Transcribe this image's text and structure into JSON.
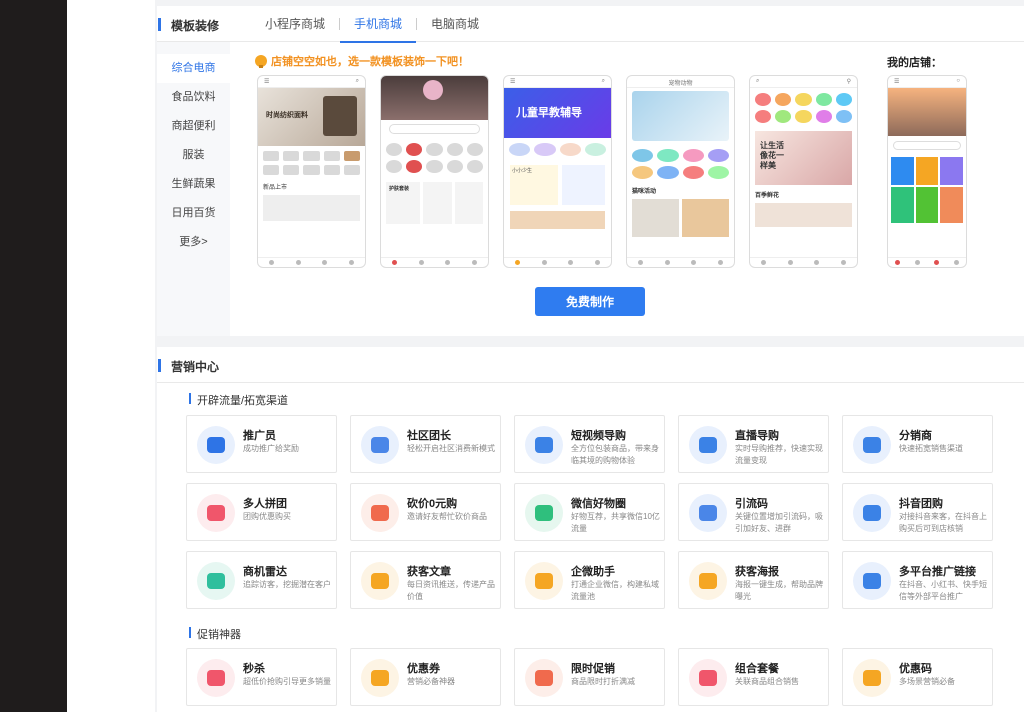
{
  "template_panel": {
    "title": "模板装修",
    "tabs": [
      "小程序商城",
      "手机商城",
      "电脑商城"
    ],
    "active_tab": 1,
    "categories": [
      "综合电商",
      "食品饮料",
      "商超便利",
      "服装",
      "生鲜蔬果",
      "日用百货",
      "更多>"
    ],
    "hint": "店铺空空如也，选一款模板装饰一下吧！",
    "my_shop_label": "我的店铺：",
    "free_button": "免费制作",
    "templates": [
      {
        "headline": "时尚纺织面料",
        "sub": "新品上市",
        "accent": "#a0907c"
      },
      {
        "headline": "",
        "sub": "护肤套装",
        "accent": "#6b5553"
      },
      {
        "headline": "儿童早教辅导",
        "sub": "小小少生",
        "accent": "#3d63e8"
      },
      {
        "headline": "宠物动物",
        "sub": "猫咪活动",
        "accent": "#8fbfdc"
      },
      {
        "headline": "让生活像花一样美",
        "sub": "百季鲜花",
        "accent": "#e8b4b8"
      },
      {
        "headline": "",
        "sub": "",
        "accent": "#f3a16b"
      }
    ]
  },
  "marketing_panel": {
    "title": "营销中心",
    "section1": "开辟流量/拓宽渠道",
    "section2": "促销神器",
    "cards_row1": [
      {
        "name": "推广员",
        "desc": "成功推广给奖励",
        "color": "#2e74e6",
        "bg": "#e8f0fd",
        "icon": "megaphone-icon"
      },
      {
        "name": "社区团长",
        "desc": "轻松开启社区消费新模式",
        "color": "#4a86e8",
        "bg": "#e8f0fd",
        "icon": "person-icon"
      },
      {
        "name": "短视频导购",
        "desc": "全方位包装商品，带来身临其境的购物体验",
        "color": "#3b82e6",
        "bg": "#e8f0fd",
        "icon": "bag-icon"
      },
      {
        "name": "直播导购",
        "desc": "实时导购推荐，快速实现流量变现",
        "color": "#3b82e6",
        "bg": "#e8f0fd",
        "icon": "clapper-icon"
      },
      {
        "name": "分销商",
        "desc": "快速拓宽销售渠道",
        "color": "#3b82e6",
        "bg": "#e8f0fd",
        "icon": "group-icon"
      }
    ],
    "cards_row2": [
      {
        "name": "多人拼团",
        "desc": "团购优惠购买",
        "color": "#f0566b",
        "bg": "#fdecee",
        "icon": "users-icon"
      },
      {
        "name": "砍价0元购",
        "desc": "邀请好友帮忙砍价商品",
        "color": "#f06a4d",
        "bg": "#fdeee9",
        "icon": "tag-icon"
      },
      {
        "name": "微信好物圈",
        "desc": "好物互荐，共享微信10亿流量",
        "color": "#2fbf7d",
        "bg": "#e6f7ef",
        "icon": "leaf-icon"
      },
      {
        "name": "引流码",
        "desc": "关键位置增加引流码，吸引加好友、进群",
        "color": "#4a86e8",
        "bg": "#e8f0fd",
        "icon": "qrcode-icon"
      },
      {
        "name": "抖音团购",
        "desc": "对接抖音来客，在抖音上购买后可到店核销",
        "color": "#3b82e6",
        "bg": "#e8f0fd",
        "icon": "tiktok-icon"
      }
    ],
    "cards_row3": [
      {
        "name": "商机雷达",
        "desc": "追踪访客，挖掘潜在客户",
        "color": "#2fbf9d",
        "bg": "#e6f7f2",
        "icon": "radar-icon"
      },
      {
        "name": "获客文章",
        "desc": "每日资讯推送，传递产品价值",
        "color": "#f5a623",
        "bg": "#fdf4e4",
        "icon": "broom-icon"
      },
      {
        "name": "企微助手",
        "desc": "打通企业微信，构建私域流量池",
        "color": "#f5a623",
        "bg": "#fdf4e4",
        "icon": "chat-icon"
      },
      {
        "name": "获客海报",
        "desc": "海报一键生成，帮助品牌曝光",
        "color": "#f5a623",
        "bg": "#fdf4e4",
        "icon": "poster-icon"
      },
      {
        "name": "多平台推广链接",
        "desc": "在抖音、小红书、快手短信等外部平台推广",
        "color": "#3b82e6",
        "bg": "#e8f0fd",
        "icon": "link-icon"
      }
    ],
    "cards_row4": [
      {
        "name": "秒杀",
        "desc": "超低价抢购引导更多销量",
        "color": "#f0566b",
        "bg": "#fdecee",
        "icon": "flash-icon"
      },
      {
        "name": "优惠券",
        "desc": "营销必备神器",
        "color": "#f5a623",
        "bg": "#fdf4e4",
        "icon": "coupon-icon"
      },
      {
        "name": "限时促销",
        "desc": "商品限时打折满减",
        "color": "#f06a4d",
        "bg": "#fdeee9",
        "icon": "percent-icon"
      },
      {
        "name": "组合套餐",
        "desc": "关联商品组合销售",
        "color": "#f0566b",
        "bg": "#fdecee",
        "icon": "basket-icon"
      },
      {
        "name": "优惠码",
        "desc": "多场景营销必备",
        "color": "#f5a623",
        "bg": "#fdf4e4",
        "icon": "code-icon"
      }
    ]
  }
}
